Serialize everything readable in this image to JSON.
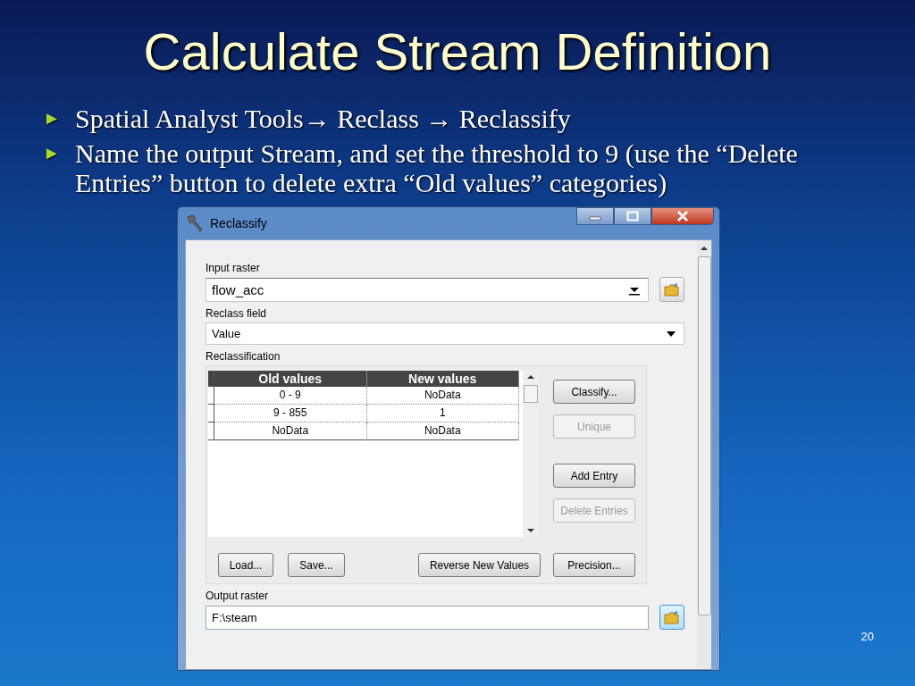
{
  "slide": {
    "title": "Calculate Stream Definition",
    "page_number": "20"
  },
  "bullets": [
    {
      "marker": "►",
      "text": "Spatial Analyst Tools→ Reclass → Reclassify"
    },
    {
      "marker": "►",
      "text": "Name the output Stream, and set the threshold to 9 (use the “Delete Entries” button to delete extra “Old values” categories)"
    }
  ],
  "dialog": {
    "title": "Reclassify",
    "input_raster": {
      "label": "Input raster",
      "value": "flow_acc"
    },
    "reclass_field": {
      "label": "Reclass field",
      "value": "Value"
    },
    "reclassification": {
      "label": "Reclassification",
      "columns": [
        "Old values",
        "New values"
      ],
      "rows": [
        {
          "old": "0 - 9",
          "new": "NoData"
        },
        {
          "old": "9 - 855",
          "new": "1"
        },
        {
          "old": "NoData",
          "new": "NoData"
        }
      ],
      "side_buttons": [
        {
          "label": "Classify...",
          "disabled": false
        },
        {
          "label": "Unique",
          "disabled": true
        },
        {
          "label": "Add Entry",
          "disabled": false
        },
        {
          "label": "Delete Entries",
          "disabled": true
        }
      ],
      "bottom_buttons": [
        "Load...",
        "Save...",
        "Reverse New Values",
        "Precision..."
      ]
    },
    "output_raster": {
      "label": "Output raster",
      "value": "F:\\steam"
    }
  }
}
